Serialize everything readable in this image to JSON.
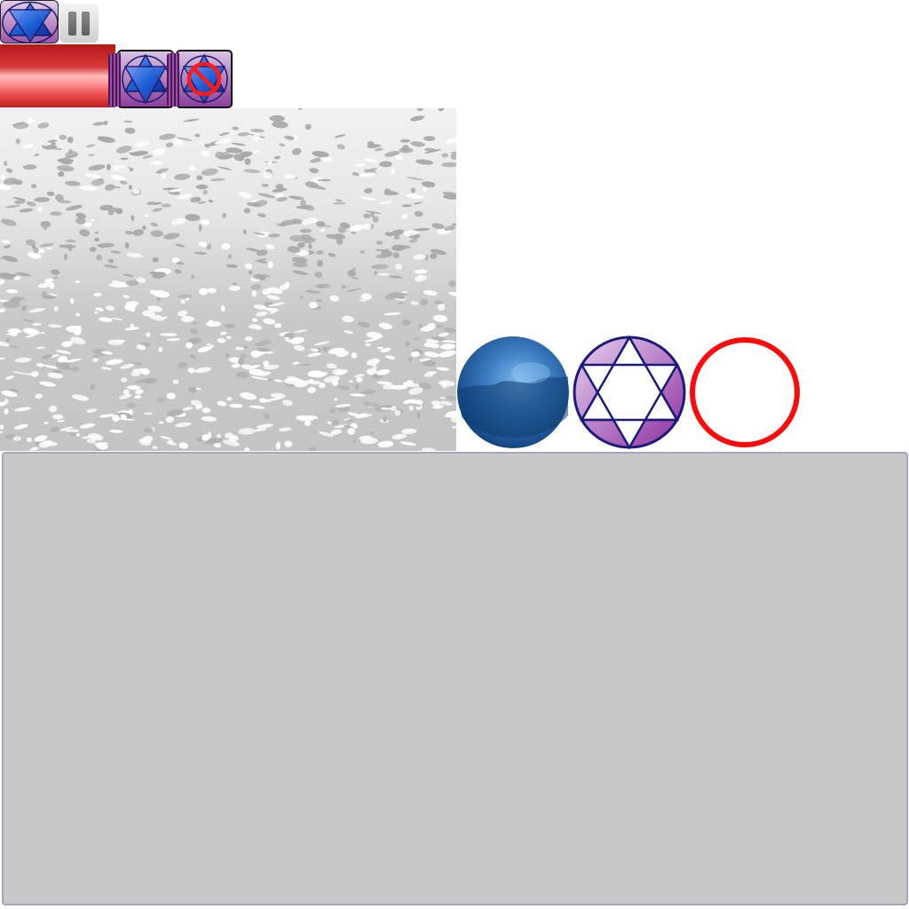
{
  "hud": {
    "logo_icon": "hexagram-emblem-icon",
    "pause_icon": "pause-icon",
    "health_fraction": 1.0,
    "colors": {
      "health_red": "#c82828",
      "card_purple": "#9a56a8",
      "gem_blue": "#1f5fd6",
      "forbidden_red": "#ff1a1a"
    }
  },
  "power_cards": [
    {
      "name": "hexagram-power-card",
      "icon": "hexagram-gem-icon"
    },
    {
      "name": "blocked-power-card",
      "icon": "hexagram-forbidden-icon"
    }
  ],
  "playfield": {
    "texture": "frost-noise",
    "orbs": [
      {
        "name": "blue-marble-orb",
        "icon": "blue-sphere-icon"
      },
      {
        "name": "hexagram-orb",
        "icon": "hexagram-circle-icon"
      },
      {
        "name": "empty-orb-slot",
        "icon": "red-ring-icon"
      }
    ]
  },
  "bottom_panel": {
    "name": "empty-gray-panel"
  }
}
